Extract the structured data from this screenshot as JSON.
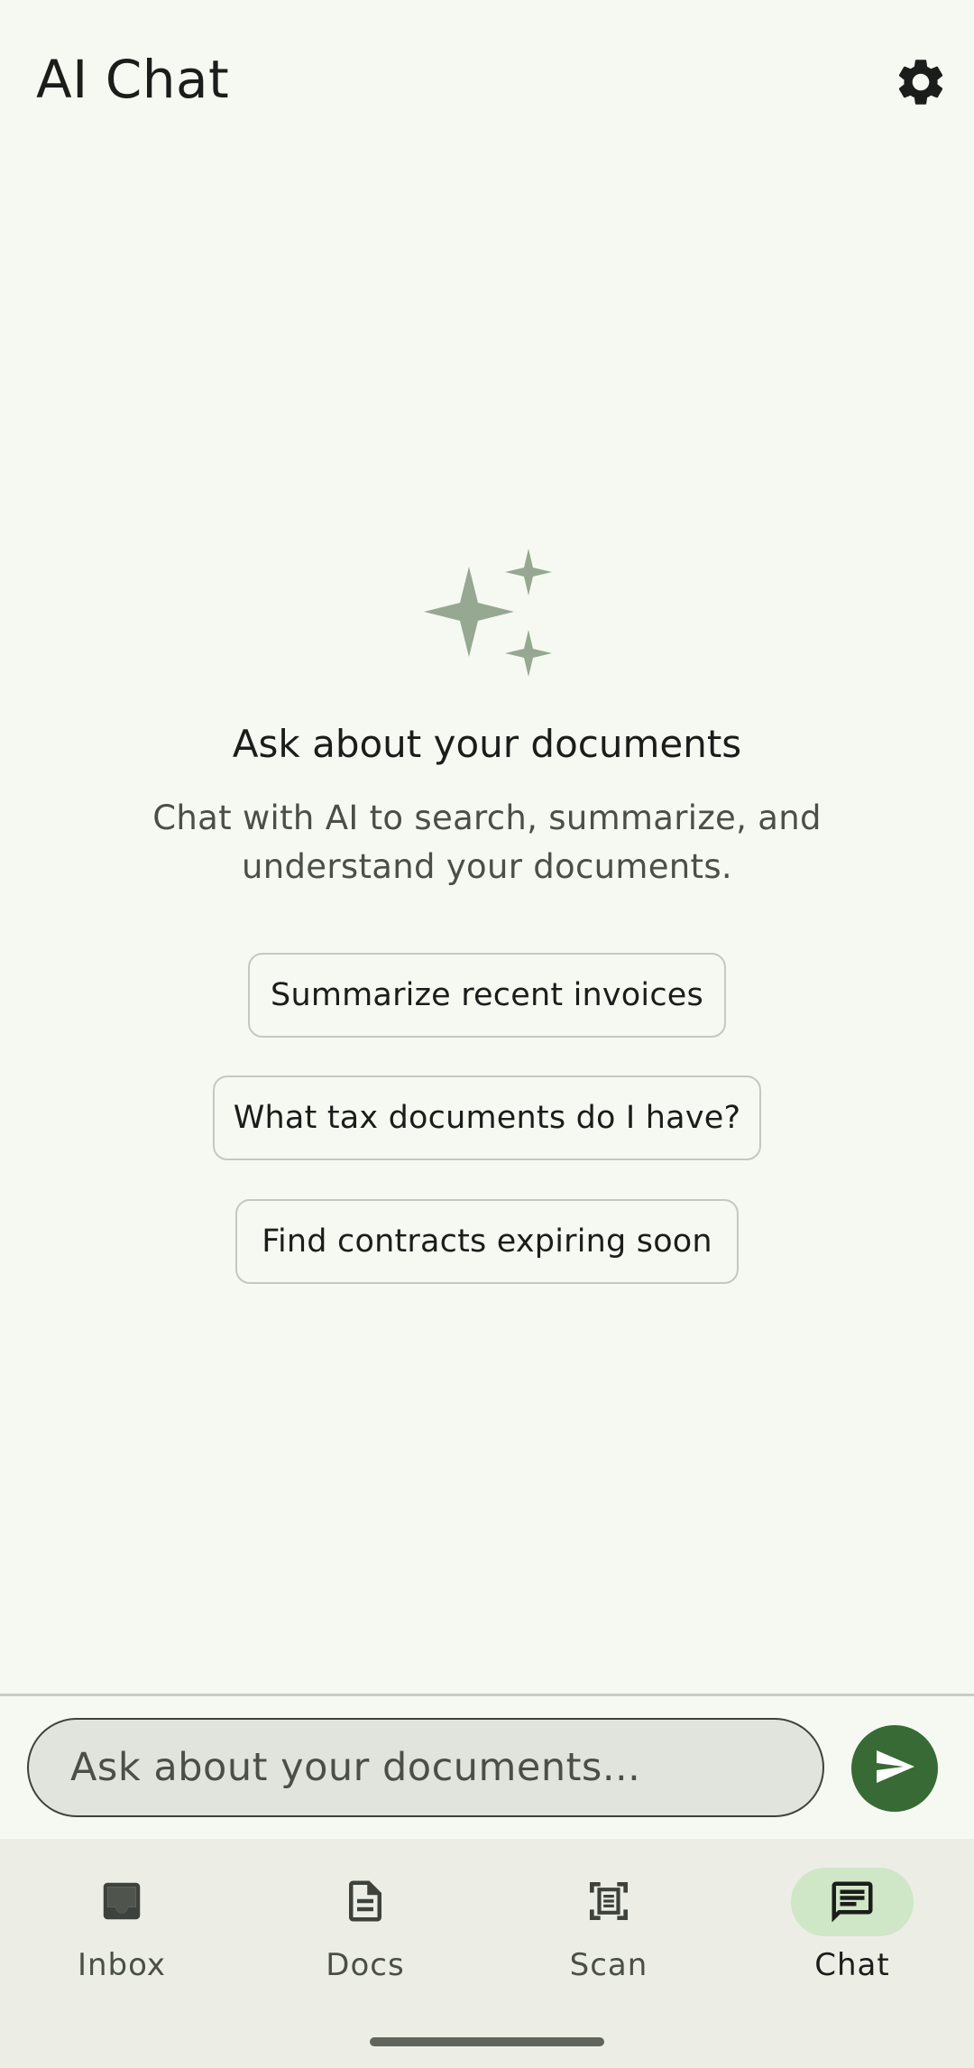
{
  "app_bar": {
    "title": "AI Chat",
    "settings_icon": "gear-icon"
  },
  "empty_state": {
    "icon": "sparkles-icon",
    "heading": "Ask about your documents",
    "subtext": "Chat with AI to search, summarize, and understand your documents."
  },
  "suggestions": [
    {
      "label": "Summarize recent invoices"
    },
    {
      "label": "What tax documents do I have?"
    },
    {
      "label": "Find contracts expiring soon"
    }
  ],
  "composer": {
    "placeholder": "Ask about your documents...",
    "send_icon": "send-icon"
  },
  "nav": {
    "items": [
      {
        "label": "Inbox",
        "icon": "inbox-icon",
        "active": false
      },
      {
        "label": "Docs",
        "icon": "document-icon",
        "active": false
      },
      {
        "label": "Scan",
        "icon": "scan-icon",
        "active": false
      },
      {
        "label": "Chat",
        "icon": "chat-icon",
        "active": true
      }
    ]
  },
  "colors": {
    "background": "#f6f9f2",
    "accent": "#386a35",
    "active_indicator": "#cfe6c7",
    "sparkle": "#97a892"
  }
}
